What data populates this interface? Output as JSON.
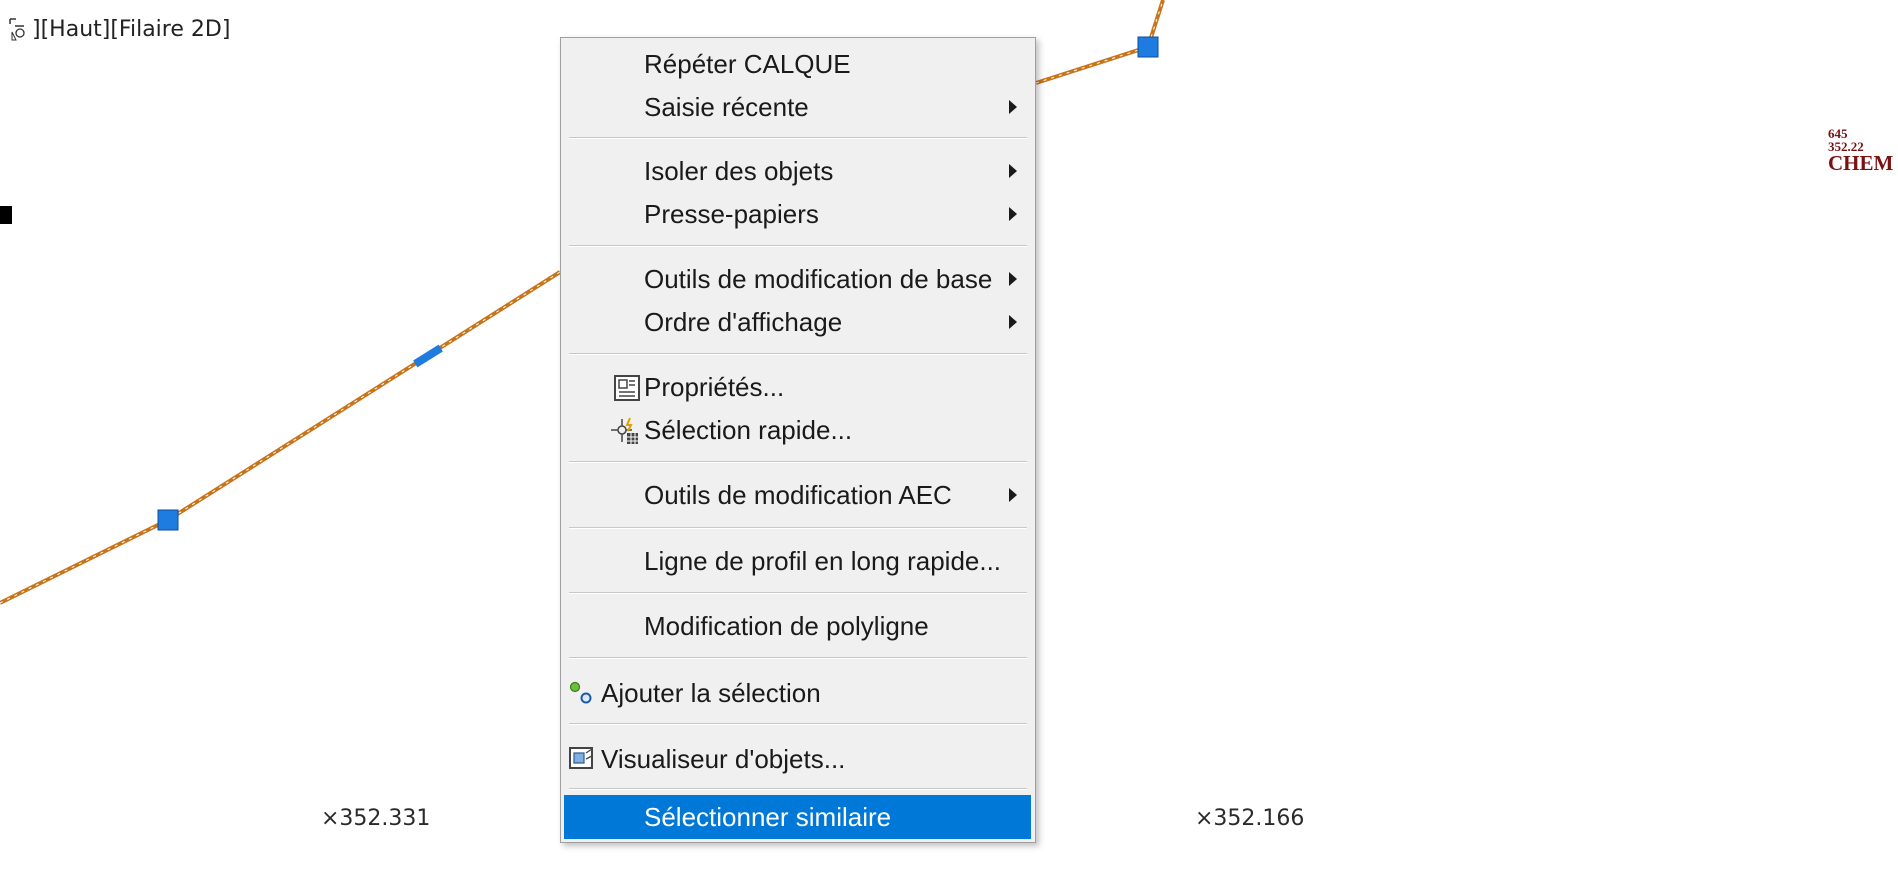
{
  "viewport": {
    "label": "][Haut][Filaire 2D]",
    "icon": "viewport-controls-icon"
  },
  "canvas": {
    "polyline_color": "#c8741a",
    "grip_color": "#1e7be0",
    "point_labels": [
      "×352.331",
      "×352.166"
    ],
    "survey_label": {
      "line1": "645",
      "line2": "352.22",
      "line3": "CHEM",
      "color": "#7a1010"
    }
  },
  "context_menu": {
    "items": [
      {
        "label": "Répéter CALQUE",
        "submenu": false
      },
      {
        "label": "Saisie récente",
        "submenu": true
      },
      {
        "label": "Isoler des objets",
        "submenu": true
      },
      {
        "label": "Presse-papiers",
        "submenu": true
      },
      {
        "label": "Outils de modification de base",
        "submenu": true
      },
      {
        "label": "Ordre d'affichage",
        "submenu": true
      },
      {
        "label": "Propriétés...",
        "submenu": false,
        "icon": "properties-icon"
      },
      {
        "label": "Sélection rapide...",
        "submenu": false,
        "icon": "quick-select-icon"
      },
      {
        "label": "Outils de modification AEC",
        "submenu": true
      },
      {
        "label": "Ligne de profil en long rapide...",
        "submenu": false
      },
      {
        "label": "Modification de polyligne",
        "submenu": false
      },
      {
        "label": "Ajouter la sélection",
        "submenu": false,
        "icon": "add-selected-icon"
      },
      {
        "label": "Visualiseur d'objets...",
        "submenu": false,
        "icon": "object-viewer-icon"
      },
      {
        "label": "Sélectionner similaire",
        "submenu": false,
        "highlighted": true
      }
    ],
    "highlight_color": "#0078d7"
  }
}
